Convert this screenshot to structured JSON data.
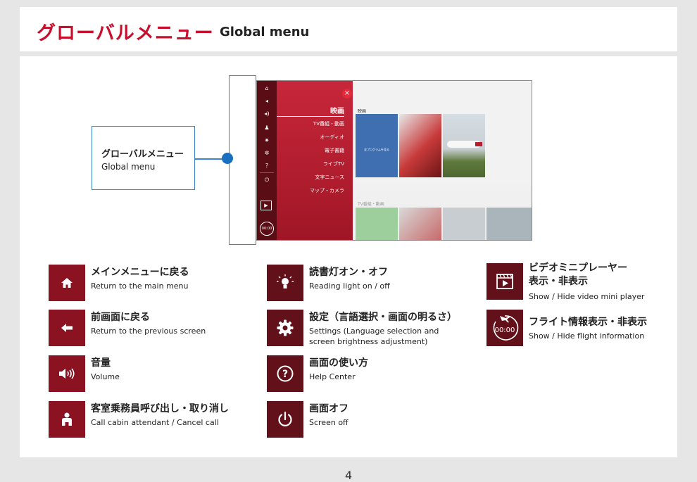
{
  "header": {
    "title_jp": "グローバルメニュー",
    "title_en": "Global menu"
  },
  "screen": {
    "menu_items": [
      "映画",
      "TV番組・動画",
      "オーディオ",
      "電子書籍",
      "ライブTV",
      "文字ニュース",
      "マップ・カメラ"
    ],
    "section_movies": "映画",
    "section_tv": "TV番組・動画",
    "tile_program_text": "全プログラムを見る",
    "flight_time": "00:00"
  },
  "callout": {
    "title_jp": "グローバルメニュー",
    "title_en": "Global menu"
  },
  "legend": [
    {
      "icon": "home-icon",
      "jp": "メインメニューに戻る",
      "en": "Return to the main menu"
    },
    {
      "icon": "back-arrow-icon",
      "jp": "前画面に戻る",
      "en": "Return to the previous screen"
    },
    {
      "icon": "volume-icon",
      "jp": "音量",
      "en": "Volume"
    },
    {
      "icon": "attendant-icon",
      "jp": "客室乗務員呼び出し・取り消し",
      "en": "Call cabin attendant / Cancel call"
    },
    {
      "icon": "reading-light-icon",
      "jp": "読書灯オン・オフ",
      "en": "Reading light on / off"
    },
    {
      "icon": "settings-gear-icon",
      "jp": "設定（言語選択・画面の明るさ）",
      "en1": "Settings (Language selection and",
      "en2": "screen brightness adjustment)"
    },
    {
      "icon": "help-icon",
      "jp": "画面の使い方",
      "en": "Help Center"
    },
    {
      "icon": "power-icon",
      "jp": "画面オフ",
      "en": "Screen off"
    },
    {
      "icon": "video-player-icon",
      "jp1": "ビデオミニプレーヤー",
      "jp2": "表示・非表示",
      "en": "Show / Hide video mini player"
    },
    {
      "icon": "flight-info-icon",
      "jp": "フライト情報表示・非表示",
      "en": "Show / Hide flight information",
      "time": "00:00"
    }
  ],
  "page_number": "4"
}
